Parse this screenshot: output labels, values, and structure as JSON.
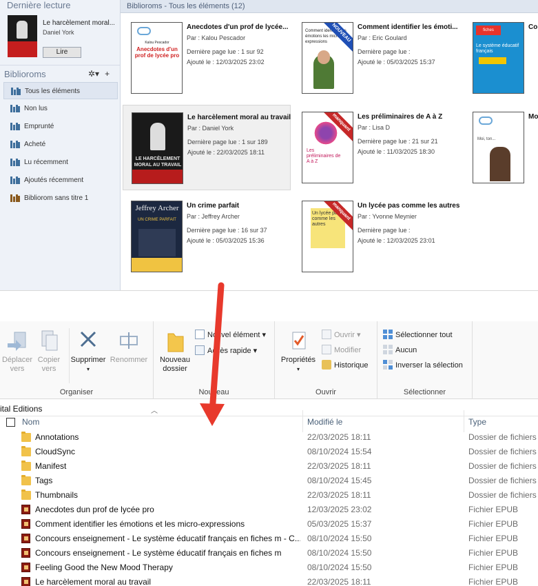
{
  "ade": {
    "last_read": {
      "heading": "Dernière lecture",
      "book_title": "Le harcèlement moral...",
      "author": "Daniel York",
      "read_button": "Lire"
    },
    "bibliorooms_heading": "Biblioroms",
    "tools": {
      "settings_icon": "gear-icon",
      "add_icon": "plus-icon",
      "settings": "✲▾",
      "add": "+"
    },
    "shelves": [
      {
        "label": "Tous les éléments",
        "selected": true
      },
      {
        "label": "Non lus"
      },
      {
        "label": "Emprunté"
      },
      {
        "label": "Acheté"
      },
      {
        "label": "Lu récemment"
      },
      {
        "label": "Ajoutés récemment"
      },
      {
        "label": "Bibliorom sans titre 1"
      }
    ],
    "header": "Biblioroms - Tous les éléments (12)",
    "labels": {
      "par": "Par :",
      "last_page": "Dernière page lue :",
      "added": "Ajouté le :"
    },
    "books": [
      {
        "title": "Anecdotes d'un prof de lycée...",
        "author": "Kalou Pescador",
        "last_page": "1 sur 92",
        "added": "12/03/2025 23:02",
        "cover_text": "Anecdotes d'un prof de lycée pro",
        "cover_author": "Kalou Pescador"
      },
      {
        "title": "Comment identifier les émoti...",
        "author": "Eric Goulard",
        "last_page": "",
        "added": "05/03/2025 15:37",
        "ribbon": "NOUVEAU",
        "cover_text": "Comment identifier les émotions les micro expressions"
      },
      {
        "title": "Con...",
        "author": "",
        "last_page": "",
        "added": "",
        "cover_text": "Le système éducatif français",
        "cover_banner": "fiches"
      },
      {
        "title": "Le harcèlement moral au travail",
        "author": "Daniel York",
        "last_page": "1 sur 189",
        "added": "22/03/2025 18:11",
        "selected": true,
        "cover_text": "LE HARCÈLEMENT MORAL AU TRAVAIL"
      },
      {
        "title": "Les préliminaires de A à Z",
        "author": "Lisa D",
        "last_page": "21 sur 21",
        "added": "11/03/2025 18:30",
        "ribbon": "manquant",
        "cover_text": "Les préliminaires de A à Z"
      },
      {
        "title": "Moi...",
        "author": "",
        "last_page": "",
        "added": "",
        "cover_text": "Moi, ...",
        "cover_label": "Moi, ton..."
      },
      {
        "title": "Un crime parfait",
        "author": "Jeffrey Archer",
        "last_page": "16 sur 37",
        "added": "05/03/2025 15:36",
        "cover_text": "Jeffrey Archer",
        "cover_sub": "UN CRIME PARFAIT"
      },
      {
        "title": "Un lycée pas comme les autres",
        "author": "Yvonne Meynier",
        "last_page": "",
        "added": "12/03/2025 23:01",
        "ribbon": "manquant",
        "cover_text": "Un lycée pas comme les autres"
      }
    ]
  },
  "explorer": {
    "groups": {
      "organiser": "Organiser",
      "nouveau": "Nouveau",
      "ouvrir": "Ouvrir",
      "selectionner": "Sélectionner"
    },
    "buttons": {
      "move": "Déplacer vers",
      "copy": "Copier vers",
      "delete": "Supprimer",
      "rename": "Renommer",
      "new_folder": "Nouveau dossier",
      "new_item": "Nouvel élément ▾",
      "quick_access": "Accès rapide ▾",
      "properties": "Propriétés",
      "open": "Ouvrir ▾",
      "edit": "Modifier",
      "history": "Historique",
      "select_all": "Sélectionner tout",
      "select_none": "Aucun",
      "invert": "Inverser la sélection"
    },
    "path": "ital Editions",
    "columns": {
      "name": "Nom",
      "modified": "Modifié le",
      "type": "Type"
    },
    "files": [
      {
        "name": "Annotations",
        "modified": "22/03/2025 18:11",
        "type": "Dossier de fichiers",
        "kind": "folder"
      },
      {
        "name": "CloudSync",
        "modified": "08/10/2024 15:54",
        "type": "Dossier de fichiers",
        "kind": "folder"
      },
      {
        "name": "Manifest",
        "modified": "22/03/2025 18:11",
        "type": "Dossier de fichiers",
        "kind": "folder"
      },
      {
        "name": "Tags",
        "modified": "08/10/2024 15:45",
        "type": "Dossier de fichiers",
        "kind": "folder"
      },
      {
        "name": "Thumbnails",
        "modified": "22/03/2025 18:11",
        "type": "Dossier de fichiers",
        "kind": "folder"
      },
      {
        "name": "Anecdotes dun prof de lycée pro",
        "modified": "12/03/2025 23:02",
        "type": "Fichier EPUB",
        "kind": "epub"
      },
      {
        "name": "Comment identifier les émotions et les micro-expressions",
        "modified": "05/03/2025 15:37",
        "type": "Fichier EPUB",
        "kind": "epub"
      },
      {
        "name": "Concours enseignement - Le système éducatif français en fiches m - C...",
        "modified": "08/10/2024 15:50",
        "type": "Fichier EPUB",
        "kind": "epub"
      },
      {
        "name": "Concours enseignement - Le système éducatif français en fiches m",
        "modified": "08/10/2024 15:50",
        "type": "Fichier EPUB",
        "kind": "epub"
      },
      {
        "name": "Feeling Good the New Mood Therapy",
        "modified": "08/10/2024 15:50",
        "type": "Fichier EPUB",
        "kind": "epub"
      },
      {
        "name": "Le harcèlement moral au travail",
        "modified": "22/03/2025 18:11",
        "type": "Fichier EPUB",
        "kind": "epub"
      }
    ]
  },
  "colors": {
    "arrow": "#e8392c",
    "accent": "#3f6f9c"
  }
}
